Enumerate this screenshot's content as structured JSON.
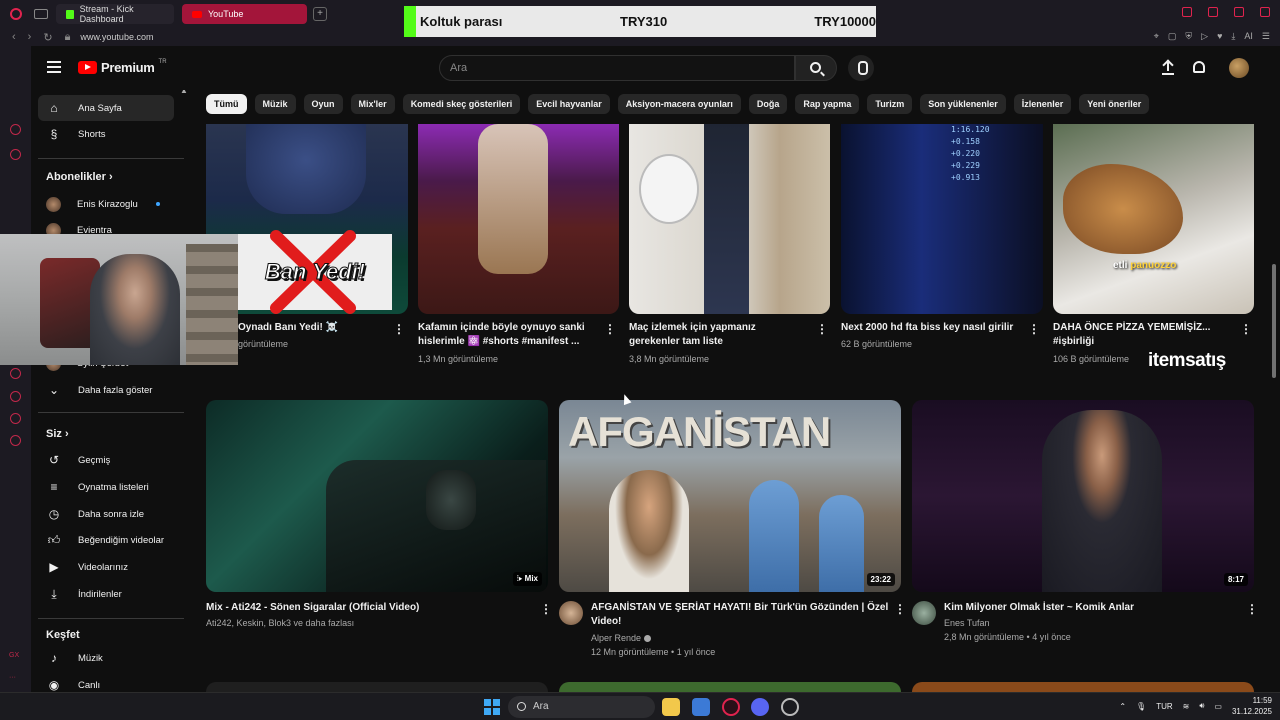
{
  "browser": {
    "tabs": [
      {
        "label": "Stream - Kick Dashboard",
        "active": false
      },
      {
        "label": "YouTube",
        "active": true
      }
    ],
    "url": "www.youtube.com",
    "extension_label": "AI"
  },
  "donation": {
    "title": "Koltuk parası",
    "amount_current": "TRY310",
    "amount_goal": "TRY10000"
  },
  "masthead": {
    "logo_word": "Premium",
    "logo_country": "TR",
    "search_placeholder": "Ara"
  },
  "chips": [
    "Tümü",
    "Müzik",
    "Oyun",
    "Mix'ler",
    "Komedi skeç gösterileri",
    "Evcil hayvanlar",
    "Aksiyon-macera oyunları",
    "Doğa",
    "Rap yapma",
    "Turizm",
    "Son yüklenenler",
    "İzlenenler",
    "Yeni öneriler"
  ],
  "guide": {
    "home": "Ana Sayfa",
    "shorts": "Shorts",
    "subs_header": "Abonelikler",
    "sub1": "Enis Kirazoglu",
    "sub2": "Evientra",
    "sub_partial": "Sylin Şerbet",
    "show_more": "Daha fazla göster",
    "you_header": "Siz",
    "history": "Geçmiş",
    "playlists": "Oynatma listeleri",
    "watch_later": "Daha sonra izle",
    "liked": "Beğendiğim videolar",
    "your_videos": "Videolarınız",
    "downloads": "İndirilenler",
    "explore_header": "Keşfet",
    "music": "Müzik",
    "live": "Canlı"
  },
  "overlay": {
    "ban_text": "Ban Yedi!",
    "watermark": "itemsatış",
    "pizza_caption_a": "etli ",
    "pizza_caption_b": "panuozzo",
    "afg_title": "AFGANİSTAN"
  },
  "row1": [
    {
      "title": "Oynadı Banı Yedi! ☠️",
      "title2": "",
      "meta": "görüntüleme"
    },
    {
      "title": "Kafamın içinde böyle oynuyo sanki",
      "title2": "hislerimle ⚛️ #shorts #manifest ...",
      "meta": "1,3 Mn görüntüleme"
    },
    {
      "title": "Maç izlemek için yapmanız",
      "title2": "gerekenler tam liste",
      "meta": "3,8 Mn görüntüleme"
    },
    {
      "title": "Next 2000 hd fta biss key nasıl girilir",
      "title2": "",
      "meta": "62 B görüntüleme"
    },
    {
      "title": "DAHA ÖNCE PİZZA YEMEMİŞİZ...",
      "title2": "#işbirliği",
      "meta": "106 B görüntüleme"
    }
  ],
  "row2": [
    {
      "title": "Mix - Ati242 - Sönen Sigaralar (Official Video)",
      "title2": "",
      "channel": "Ati242, Keskin, Blok3 ve daha fazlası",
      "meta": "",
      "badge": "Mix"
    },
    {
      "title": "AFGANİSTAN VE ŞERİAT HAYATI! Bir Türk'ün Gözünden | Özel",
      "title2": "Video!",
      "channel": "Alper Rende",
      "meta": "12 Mn görüntüleme • 1 yıl önce",
      "badge": "23:22"
    },
    {
      "title": "Kim Milyoner Olmak İster ~ Komik Anlar",
      "title2": "",
      "channel": "Enes Tufan",
      "meta": "2,8 Mn görüntüleme • 4 yıl önce",
      "badge": "8:17"
    }
  ],
  "rank_labels": [
    "1:16.120",
    "+0.158",
    "+0.220",
    "+0.229",
    "+0.913"
  ],
  "taskbar": {
    "search_placeholder": "Ara",
    "lang": "TUR",
    "time": "11:59",
    "date": "31.12.2025"
  },
  "colors": {
    "accent_red": "#ff0000",
    "opera_red": "#e0234e",
    "kick_green": "#53fc18"
  }
}
